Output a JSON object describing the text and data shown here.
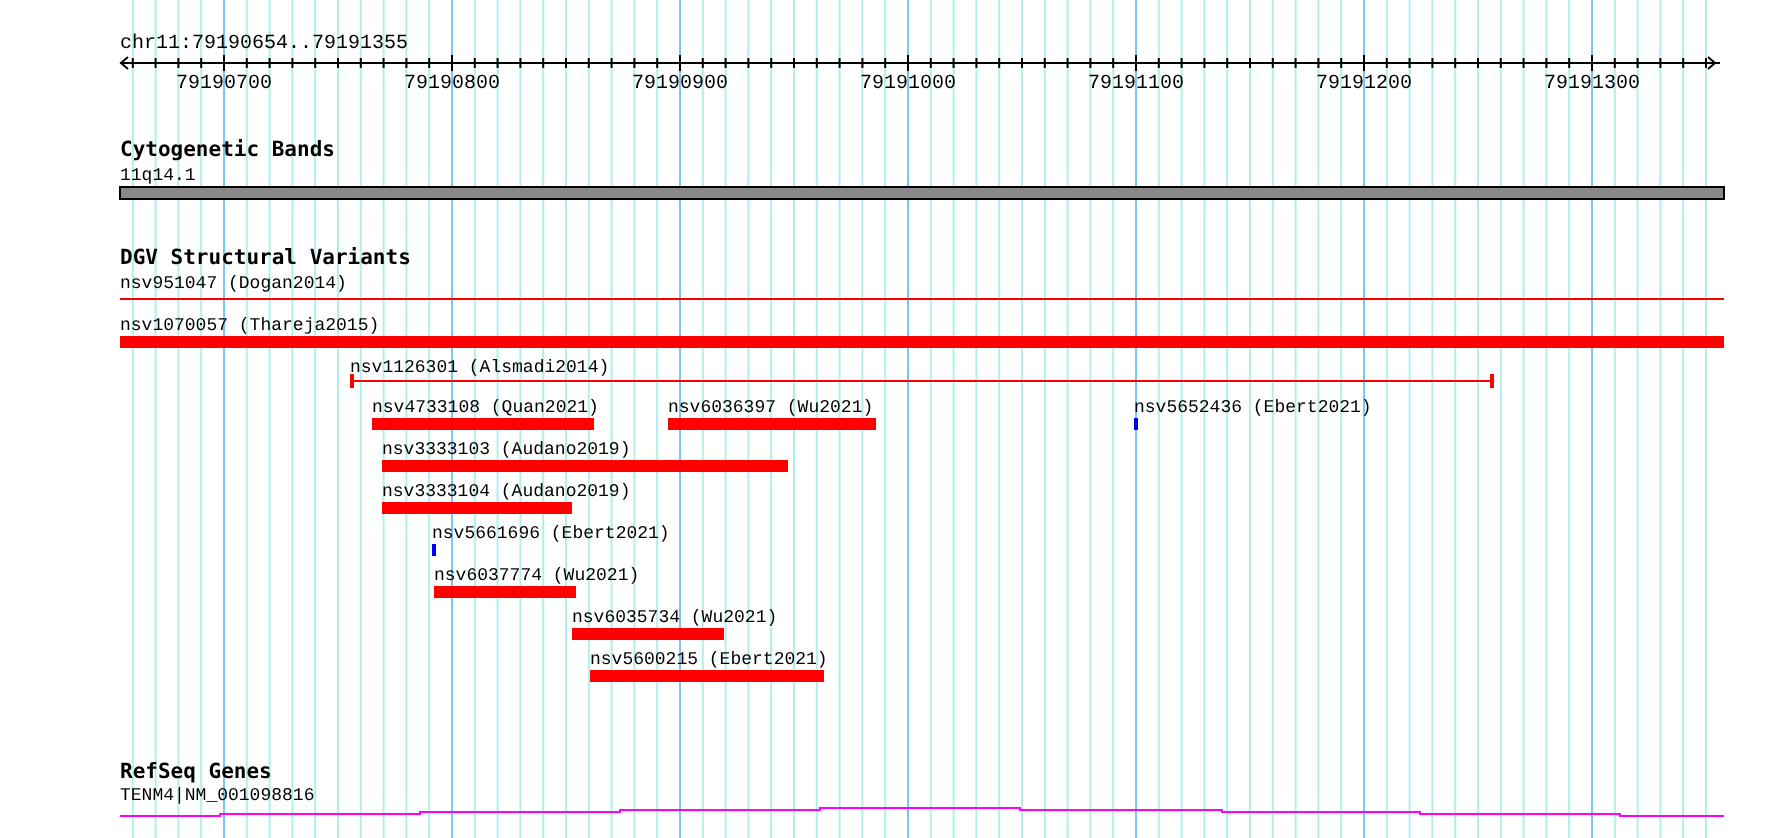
{
  "ruler": {
    "location": "chr11:79190654..79191355",
    "ticks": [
      "79190700",
      "79190800",
      "79190900",
      "79191000",
      "79191100",
      "79191200",
      "79191300"
    ]
  },
  "tracks": [
    {
      "kind": "cytoband",
      "title": "Cytogenetic Bands",
      "features": [
        {
          "label": "11q14.1"
        }
      ]
    },
    {
      "kind": "variants",
      "title": "DGV Structural Variants",
      "features": [
        {
          "label": "nsv951047 (Dogan2014)",
          "kind": "line",
          "color": "#ff0000"
        },
        {
          "label": "nsv1070057 (Thareja2015)",
          "kind": "bar",
          "color": "#ff0000"
        },
        {
          "label": "nsv1126301 (Alsmadi2014)",
          "kind": "capped",
          "color": "#ff0000"
        },
        {
          "label": "nsv4733108 (Quan2021)",
          "kind": "bar",
          "color": "#ff0000"
        },
        {
          "label": "nsv6036397 (Wu2021)",
          "kind": "bar",
          "color": "#ff0000"
        },
        {
          "label": "nsv5652436 (Ebert2021)",
          "kind": "bar",
          "color": "#0000ff"
        },
        {
          "label": "nsv3333103 (Audano2019)",
          "kind": "bar",
          "color": "#ff0000"
        },
        {
          "label": "nsv3333104 (Audano2019)",
          "kind": "bar",
          "color": "#ff0000"
        },
        {
          "label": "nsv5661696 (Ebert2021)",
          "kind": "bar",
          "color": "#0000ff"
        },
        {
          "label": "nsv6037774 (Wu2021)",
          "kind": "bar",
          "color": "#ff0000"
        },
        {
          "label": "nsv6035734 (Wu2021)",
          "kind": "bar",
          "color": "#ff0000"
        },
        {
          "label": "nsv5600215 (Ebert2021)",
          "kind": "bar",
          "color": "#ff0000"
        }
      ]
    },
    {
      "kind": "genes",
      "title": "RefSeq Genes",
      "features": [
        {
          "label": "TENM4|NM_001098816"
        }
      ]
    }
  ]
}
